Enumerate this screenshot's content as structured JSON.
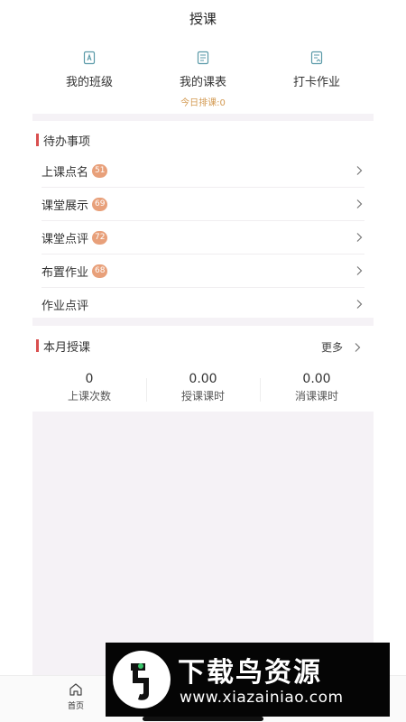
{
  "header": {
    "title": "授课"
  },
  "quick_links": [
    {
      "label": "我的班级",
      "icon": "class-icon"
    },
    {
      "label": "我的课表",
      "icon": "schedule-icon",
      "sub": "今日排课:0"
    },
    {
      "label": "打卡作业",
      "icon": "homework-icon"
    }
  ],
  "todo": {
    "title": "待办事项",
    "items": [
      {
        "label": "上课点名",
        "badge": "51"
      },
      {
        "label": "课堂展示",
        "badge": "69"
      },
      {
        "label": "课堂点评",
        "badge": "72"
      },
      {
        "label": "布置作业",
        "badge": "68"
      },
      {
        "label": "作业点评"
      }
    ]
  },
  "month": {
    "title": "本月授课",
    "more_label": "更多",
    "stats": [
      {
        "value": "0",
        "label": "上课次数"
      },
      {
        "value": "0.00",
        "label": "授课课时"
      },
      {
        "value": "0.00",
        "label": "消课课时"
      }
    ]
  },
  "tabbar": {
    "home_label": "首页"
  },
  "watermark": {
    "title": "下载鸟资源",
    "url": "www.xiazainiao.com"
  },
  "colors": {
    "accent_bar": "#d94f4f",
    "badge": "#e8a07a",
    "sub_text": "#d39a52",
    "icon": "#5a9aa8"
  }
}
